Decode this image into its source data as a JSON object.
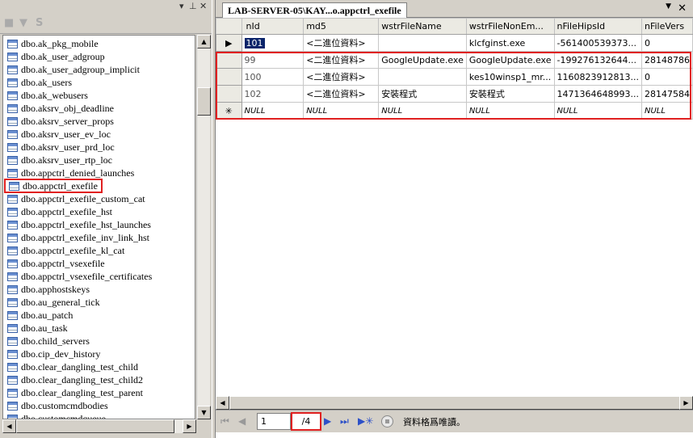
{
  "tree": {
    "items": [
      "dbo.ak_pkg_mobile",
      "dbo.ak_user_adgroup",
      "dbo.ak_user_adgroup_implicit",
      "dbo.ak_users",
      "dbo.ak_webusers",
      "dbo.aksrv_obj_deadline",
      "dbo.aksrv_server_props",
      "dbo.aksrv_user_ev_loc",
      "dbo.aksrv_user_prd_loc",
      "dbo.aksrv_user_rtp_loc",
      "dbo.appctrl_denied_launches",
      "dbo.appctrl_exefile",
      "dbo.appctrl_exefile_custom_cat",
      "dbo.appctrl_exefile_hst",
      "dbo.appctrl_exefile_hst_launches",
      "dbo.appctrl_exefile_inv_link_hst",
      "dbo.appctrl_exefile_kl_cat",
      "dbo.appctrl_vsexefile",
      "dbo.appctrl_vsexefile_certificates",
      "dbo.apphostskeys",
      "dbo.au_general_tick",
      "dbo.au_patch",
      "dbo.au_task",
      "dbo.child_servers",
      "dbo.cip_dev_history",
      "dbo.clear_dangling_test_child",
      "dbo.clear_dangling_test_child2",
      "dbo.clear_dangling_test_parent",
      "dbo.customcmdbodies",
      "dbo.customcmdqueue"
    ],
    "selected_index": 11
  },
  "tab": {
    "title": "LAB-SERVER-05\\KAY...o.appctrl_exefile"
  },
  "grid": {
    "columns": [
      "nId",
      "md5",
      "wstrFileName",
      "wstrFileNonEm...",
      "nFileHipsId",
      "nFileVers"
    ],
    "rows": [
      {
        "marker": "▶",
        "cells": [
          "101",
          "<二進位資料>",
          "",
          "klcfginst.exe",
          "-561400539373...",
          "0"
        ]
      },
      {
        "marker": "",
        "cells": [
          "99",
          "<二進位資料>",
          "GoogleUpdate.exe",
          "GoogleUpdate.exe",
          "-199276132644...",
          "28148786"
        ]
      },
      {
        "marker": "",
        "cells": [
          "100",
          "<二進位資料>",
          "",
          "kes10winsp1_mr...",
          "1160823912813...",
          "0"
        ]
      },
      {
        "marker": "",
        "cells": [
          "102",
          "<二進位資料>",
          "安裝程式",
          "安裝程式",
          "1471364648993...",
          "28147584"
        ]
      },
      {
        "marker": "✳",
        "cells": [
          "NULL",
          "NULL",
          "NULL",
          "NULL",
          "NULL",
          "NULL"
        ]
      }
    ]
  },
  "nav": {
    "current_page": "1",
    "total_pages": "/4",
    "status": "資料格爲唯讀。"
  }
}
